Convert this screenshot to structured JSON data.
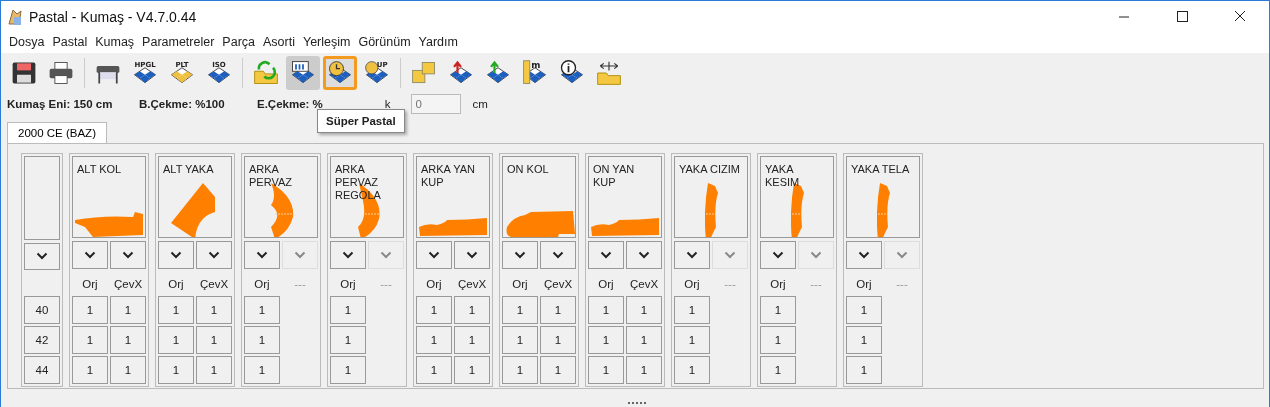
{
  "window": {
    "title": "Pastal - Kumaş - V4.7.0.44"
  },
  "menu": [
    "Dosya",
    "Pastal",
    "Kumaş",
    "Parametreler",
    "Parça",
    "Asorti",
    "Yerleşim",
    "Görünüm",
    "Yardım"
  ],
  "toolbar": [
    [
      {
        "kind": "save",
        "selected": false,
        "hovered": false
      },
      {
        "kind": "print",
        "selected": false,
        "hovered": false
      }
    ],
    [
      {
        "kind": "plotter",
        "selected": false,
        "hovered": false
      },
      {
        "kind": "diamond",
        "label": "HPGL",
        "selected": false,
        "hovered": false
      },
      {
        "kind": "diamond-yellow",
        "label": "PLT",
        "selected": false,
        "hovered": false
      },
      {
        "kind": "diamond",
        "label": "ISO",
        "selected": false,
        "hovered": false
      }
    ],
    [
      {
        "kind": "folder-arrows",
        "selected": false,
        "hovered": false
      },
      {
        "kind": "table-diamond",
        "selected": true,
        "hovered": false
      },
      {
        "kind": "clock-diamond",
        "selected": false,
        "hovered": true
      },
      {
        "kind": "diamond-moon",
        "label": "UP",
        "selected": false,
        "hovered": false
      }
    ],
    [
      {
        "kind": "squares",
        "selected": false,
        "hovered": false
      },
      {
        "kind": "arrow-red",
        "selected": false,
        "hovered": false
      },
      {
        "kind": "arrow-green",
        "selected": false,
        "hovered": false
      },
      {
        "kind": "ruler",
        "label": "m",
        "selected": false,
        "hovered": false
      },
      {
        "kind": "info",
        "selected": false,
        "hovered": false
      },
      {
        "kind": "width-folder",
        "selected": false,
        "hovered": false
      }
    ]
  ],
  "info": {
    "fabric_width": "Kumaş Eni: 150 cm",
    "b_shrink": "B.Çekme: %100",
    "e_shrink": "E.Çekme: %",
    "field_label": "k",
    "field_placeholder": "0",
    "unit": "cm"
  },
  "tooltip": "Süper Pastal",
  "tabs": [
    {
      "label": "2000 CE (BAZ)",
      "selected": true
    }
  ],
  "sizes": [
    "40",
    "42",
    "44"
  ],
  "pieces": [
    {
      "name": "ALT KOL",
      "kind": "sleeve",
      "columns": [
        {
          "label": "Orj",
          "enabled": true,
          "cells": [
            "1",
            "1",
            "1"
          ]
        },
        {
          "label": "ÇevX",
          "enabled": true,
          "cells": [
            "1",
            "1",
            "1"
          ]
        }
      ]
    },
    {
      "name": "ALT YAKA",
      "kind": "wedge",
      "columns": [
        {
          "label": "Orj",
          "enabled": true,
          "cells": [
            "1",
            "1",
            "1"
          ]
        },
        {
          "label": "ÇevX",
          "enabled": true,
          "cells": [
            "1",
            "1",
            "1"
          ]
        }
      ]
    },
    {
      "name": "ARKA PERVAZ",
      "kind": "arc",
      "columns": [
        {
          "label": "Orj",
          "enabled": true,
          "cells": [
            "1",
            "1",
            "1"
          ]
        },
        {
          "label": "---",
          "enabled": false
        }
      ]
    },
    {
      "name": "ARKA PERVAZ REGOLA",
      "kind": "arc-thin",
      "columns": [
        {
          "label": "Orj",
          "enabled": true,
          "cells": [
            "1",
            "1",
            "1"
          ]
        },
        {
          "label": "---",
          "enabled": false
        }
      ]
    },
    {
      "name": "ARKA YAN KUP",
      "kind": "strip",
      "columns": [
        {
          "label": "Orj",
          "enabled": true,
          "cells": [
            "1",
            "1",
            "1"
          ]
        },
        {
          "label": "ÇevX",
          "enabled": true,
          "cells": [
            "1",
            "1",
            "1"
          ]
        }
      ]
    },
    {
      "name": "ON KOL",
      "kind": "sleeve-wide",
      "columns": [
        {
          "label": "Orj",
          "enabled": true,
          "cells": [
            "1",
            "1",
            "1"
          ]
        },
        {
          "label": "ÇevX",
          "enabled": true,
          "cells": [
            "1",
            "1",
            "1"
          ]
        }
      ]
    },
    {
      "name": "ON YAN KUP",
      "kind": "strip",
      "columns": [
        {
          "label": "Orj",
          "enabled": true,
          "cells": [
            "1",
            "1",
            "1"
          ]
        },
        {
          "label": "ÇevX",
          "enabled": true,
          "cells": [
            "1",
            "1",
            "1"
          ]
        }
      ]
    },
    {
      "name": "YAKA CIZIM",
      "kind": "band",
      "columns": [
        {
          "label": "Orj",
          "enabled": true,
          "cells": [
            "1",
            "1",
            "1"
          ]
        },
        {
          "label": "---",
          "enabled": false
        }
      ]
    },
    {
      "name": "YAKA KESIM",
      "kind": "band",
      "columns": [
        {
          "label": "Orj",
          "enabled": true,
          "cells": [
            "1",
            "1",
            "1"
          ]
        },
        {
          "label": "---",
          "enabled": false
        }
      ]
    },
    {
      "name": "YAKA TELA",
      "kind": "band",
      "columns": [
        {
          "label": "Orj",
          "enabled": true,
          "cells": [
            "1",
            "1",
            "1"
          ]
        },
        {
          "label": "---",
          "enabled": false
        }
      ]
    }
  ]
}
